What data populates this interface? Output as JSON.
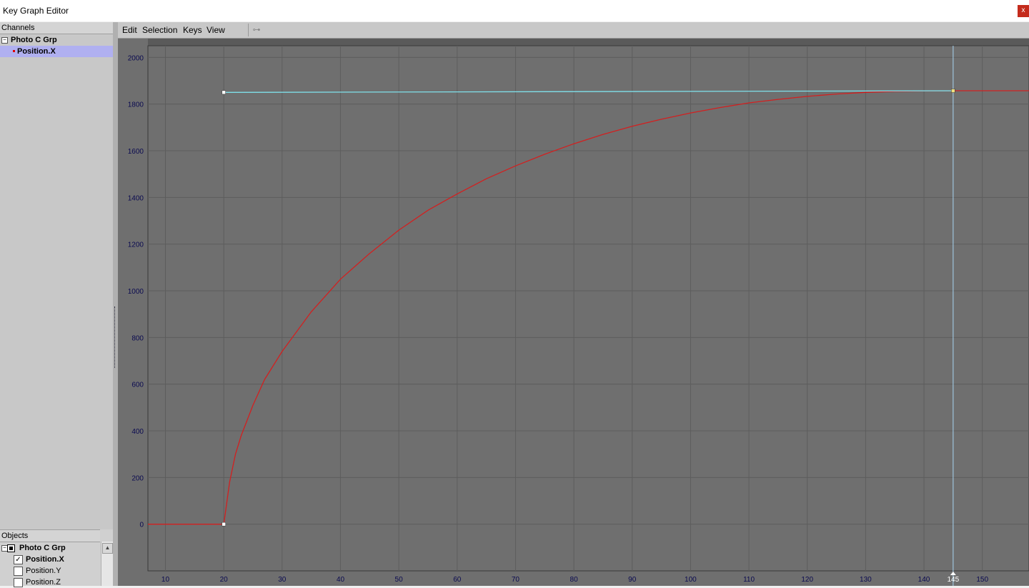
{
  "window": {
    "title": "Key Graph Editor",
    "close_label": "x"
  },
  "channels": {
    "header": "Channels",
    "group": {
      "label": "Photo C Grp",
      "toggle": "−"
    },
    "items": [
      {
        "label": "Position.X",
        "selected": true,
        "color": "#e00000"
      }
    ]
  },
  "objects": {
    "header": "Objects",
    "group": {
      "label": "Photo C Grp",
      "toggle": "−"
    },
    "items": [
      {
        "label": "Position.X",
        "checked": true
      },
      {
        "label": "Position.Y",
        "checked": false
      },
      {
        "label": "Position.Z",
        "checked": false
      }
    ]
  },
  "menu": {
    "items": [
      "Edit",
      "Selection",
      "Keys",
      "View"
    ]
  },
  "toolbar": {
    "icon": "key-tangent-icon"
  },
  "graph": {
    "current_frame": 145,
    "colors": {
      "background": "#6f6f6f",
      "grid": "#5d5d5d",
      "curve": "#d22020",
      "tangent": "#7fe0ea",
      "cursor": "#a8d4f0",
      "tick_label": "#0a0a50"
    }
  },
  "chart_data": {
    "type": "line",
    "x_ticks": [
      10,
      20,
      30,
      40,
      50,
      60,
      70,
      80,
      90,
      100,
      110,
      120,
      130,
      140,
      150
    ],
    "y_ticks": [
      0,
      200,
      400,
      600,
      800,
      1000,
      1200,
      1400,
      1600,
      1800,
      2000
    ],
    "xlim": [
      7,
      158
    ],
    "ylim": [
      -200,
      2050
    ],
    "series": [
      {
        "x": [
          7,
          20,
          21,
          22,
          23,
          25,
          27,
          30,
          35,
          40,
          45,
          50,
          55,
          60,
          65,
          70,
          75,
          80,
          85,
          90,
          95,
          100,
          105,
          110,
          115,
          120,
          125,
          130,
          135,
          140,
          145,
          150,
          158
        ],
        "values": [
          0,
          0,
          180,
          300,
          380,
          510,
          620,
          740,
          910,
          1050,
          1160,
          1260,
          1345,
          1415,
          1480,
          1535,
          1585,
          1630,
          1670,
          1705,
          1735,
          1762,
          1785,
          1805,
          1820,
          1833,
          1843,
          1850,
          1854,
          1856,
          1857,
          1857,
          1857
        ]
      }
    ],
    "keys": [
      {
        "x": 20,
        "y": 0
      },
      {
        "x": 20,
        "y": 1850
      },
      {
        "x": 145,
        "y": 1857
      }
    ],
    "tangent": {
      "from": {
        "x": 20,
        "y": 1850
      },
      "to": {
        "x": 145,
        "y": 1857
      }
    },
    "grid": true
  }
}
